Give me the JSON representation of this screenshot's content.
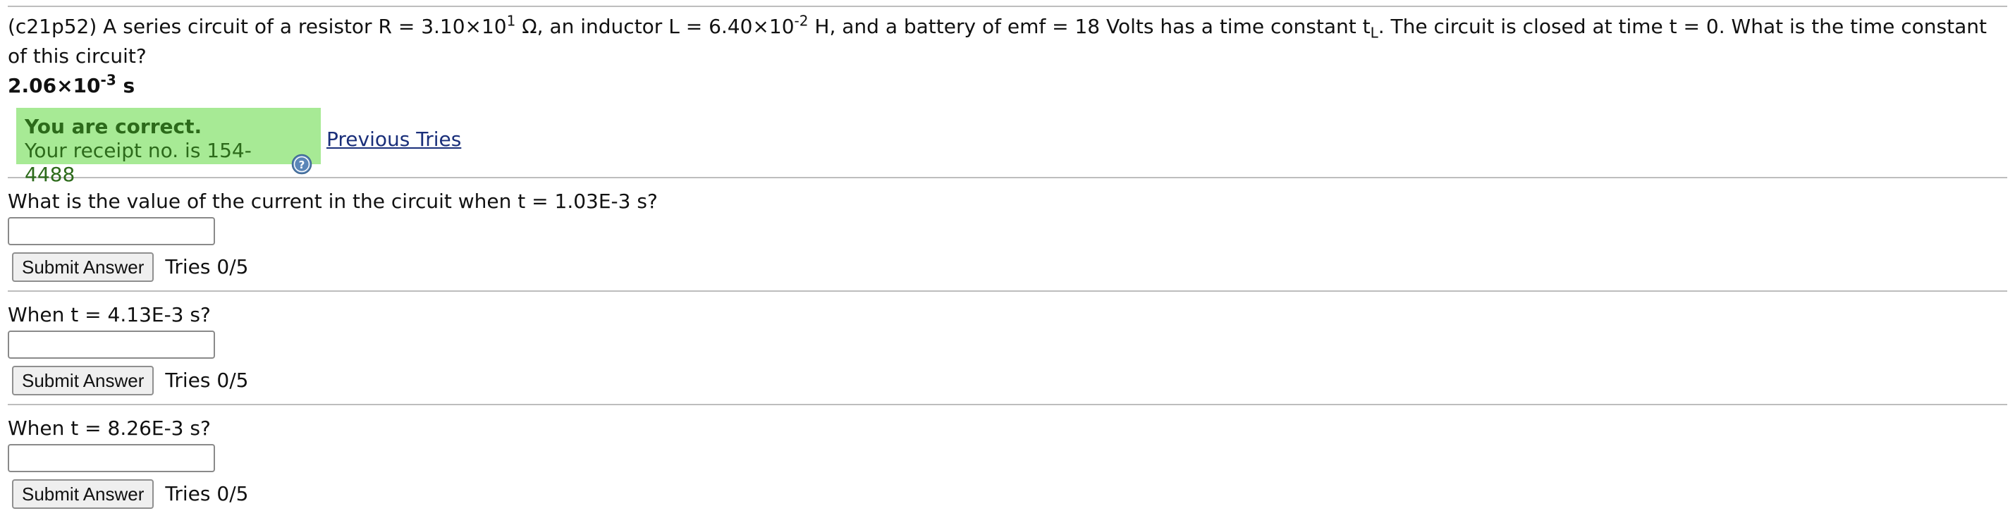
{
  "problem": {
    "id": "(c21p52)",
    "text_a": " A series circuit of a resistor R = 3.10×10",
    "r_exponent": "1",
    "text_b": " Ω, an inductor L = 6.40×10",
    "l_exponent": "-2",
    "text_c": " H, and a battery of emf = 18 Volts has a time constant t",
    "time_constant_subscript": "L",
    "text_d": ". The circuit is closed at time t = 0. What is the time constant of this circuit?"
  },
  "answer": {
    "mantissa": "2.06×10",
    "exponent": "-3",
    "unit": " s"
  },
  "feedback": {
    "title": "You are correct.",
    "receipt": "Your receipt no. is 154-4488",
    "help_icon": "question-mark-circle-icon",
    "previous_tries_link": "Previous Tries"
  },
  "parts": [
    {
      "question": "What is the value of the current in the circuit when t = 1.03E-3 s?",
      "input_value": "",
      "submit_label": "Submit Answer",
      "tries": "Tries 0/5"
    },
    {
      "question": "When t = 4.13E-3 s?",
      "input_value": "",
      "submit_label": "Submit Answer",
      "tries": "Tries 0/5"
    },
    {
      "question": "When t = 8.26E-3 s?",
      "input_value": "",
      "submit_label": "Submit Answer",
      "tries": "Tries 0/5"
    }
  ],
  "colors": {
    "correct_background": "#a7ea95",
    "correct_text": "#2c6a1a",
    "link": "#1a2f7a",
    "rule": "#bdbdbd"
  }
}
